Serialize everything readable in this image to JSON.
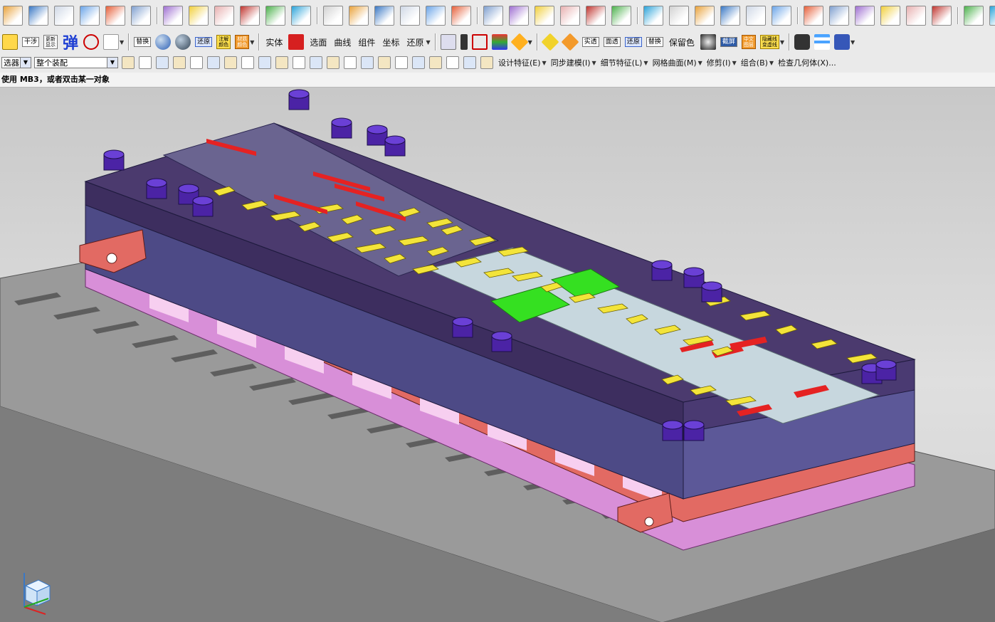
{
  "toolbar_row2": {
    "dry_label": "干涉",
    "refresh_label": "更新\n显示",
    "spring_label": "弹",
    "replace_label": "替换",
    "restore_label": "还原",
    "color_label": "注解\n颜色",
    "material_label": "材质\n颜色",
    "solid_label": "实体",
    "select_face_label": "选面",
    "curve_label": "曲线",
    "component_label": "组件",
    "coord_label": "坐标",
    "restore2_label": "还原",
    "realtrans_label": "实透",
    "facetrans_label": "面透",
    "restore3_label": "还原",
    "replace2_label": "替换",
    "keepcolor_label": "保留色",
    "screenshot_label": "截屏",
    "cnlayer_label": "中文\n图层",
    "hideline_label": "隐藏线\n变虚线"
  },
  "toolbar_row3": {
    "filter_label": "选器",
    "assembly_select": "整个装配",
    "menus": [
      "设计特征(E)",
      "同步建模(I)",
      "细节特征(L)",
      "网格曲面(M)",
      "修剪(I)",
      "组合(B)",
      "检查几何体(X)..."
    ]
  },
  "status": {
    "prompt": "使用 MB3，或者双击某一对象"
  },
  "colors": {
    "toolbar_bg": "#eaeaea",
    "viewport_top": "#c8c8c8",
    "plate_purple": "#4b3a6e",
    "plate_slate": "#5b5488",
    "block_red": "#e26a63",
    "strip_pink": "#d88fd8",
    "bench_gray": "#8f8f8f",
    "parts_yellow": "#f3e43a",
    "parts_green": "#35e021",
    "parts_red": "#e52222",
    "sheet_blue": "#c7d7de"
  },
  "icons": {
    "row1": [
      "sketch-icon",
      "datum-icon",
      "box-icon",
      "plate-icon",
      "color-cube-icon",
      "shell-icon",
      "face-icon",
      "cube-icon",
      "cube-edit-icon",
      "cube-cut-icon",
      "cube-paint-icon",
      "cube-view-icon",
      "person-icon",
      "plane-icon",
      "grid-icon",
      "view-icon",
      "diamond-icon",
      "pattern-icon",
      "pencil-icon",
      "line-icon",
      "heart-icon",
      "triangle-icon",
      "curve-icon",
      "curve2-icon",
      "curve3-icon",
      "rotate-icon",
      "offset-icon",
      "arrow-icon",
      "key-icon",
      "branch-icon",
      "curve-y-icon",
      "trim-icon",
      "fillet-icon",
      "corner-icon",
      "doc-icon",
      "bar-icon",
      "chain-icon",
      "brush-icon",
      "csys-icon",
      "target-icon"
    ],
    "row3": [
      "filter-icon",
      "funnel-icon",
      "undo-icon",
      "redo-icon",
      "fit-icon",
      "snap-icon",
      "select-icon",
      "point-icon",
      "line-snap-icon",
      "curve-snap-icon",
      "arc-icon",
      "circle-icon",
      "cross-icon",
      "slash-icon",
      "angle-icon",
      "hand-icon",
      "move-icon",
      "copy-icon",
      "measure-icon",
      "chain2-icon",
      "shape-icon",
      "cube-solid-icon"
    ]
  }
}
